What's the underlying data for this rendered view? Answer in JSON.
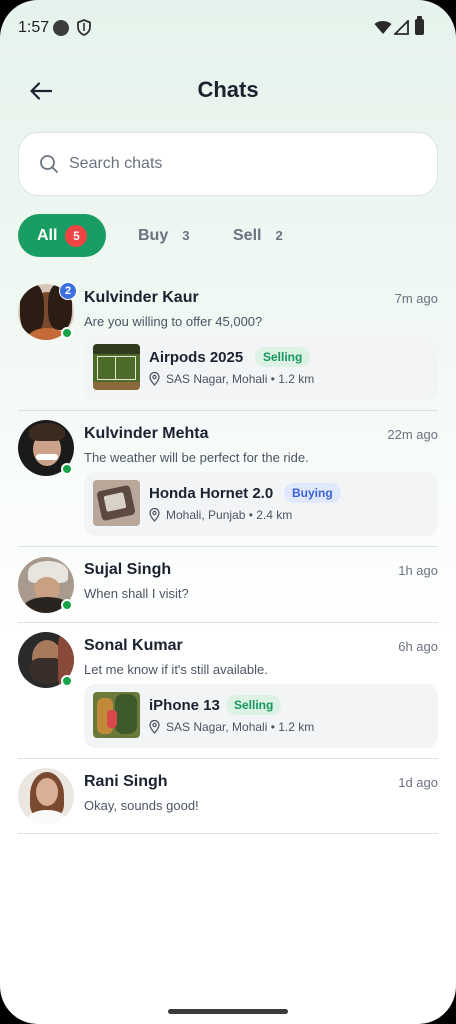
{
  "status_bar": {
    "time": "1:57"
  },
  "header": {
    "title": "Chats",
    "back_icon": "arrow-left-icon"
  },
  "search": {
    "placeholder": "Search chats",
    "icon": "search-icon"
  },
  "filters": [
    {
      "label": "All",
      "count": "5",
      "active": true
    },
    {
      "label": "Buy",
      "count": "3",
      "active": false
    },
    {
      "label": "Sell",
      "count": "2",
      "active": false
    }
  ],
  "chats": [
    {
      "name": "Kulvinder Kaur",
      "time": "7m ago",
      "message": "Are you willing to offer  45,000?",
      "unread": "2",
      "online": true,
      "listing": {
        "title": "Airpods 2025",
        "tag": "Selling",
        "location": "SAS Nagar, Mohali • 1.2 km"
      }
    },
    {
      "name": "Kulvinder Mehta",
      "time": "22m ago",
      "message": "The weather will be perfect for the ride.",
      "online": true,
      "listing": {
        "title": "Honda Hornet 2.0",
        "tag": "Buying",
        "location": "Mohali, Punjab • 2.4 km"
      }
    },
    {
      "name": "Sujal Singh",
      "time": "1h ago",
      "message": "When shall I visit?",
      "online": true
    },
    {
      "name": "Sonal Kumar",
      "time": "6h ago",
      "message": "Let me know if it's still available.",
      "online": true,
      "listing": {
        "title": "iPhone 13",
        "tag": "Selling",
        "location": "SAS Nagar, Mohali • 1.2 km"
      }
    },
    {
      "name": "Rani Singh",
      "time": "1d ago",
      "message": "Okay, sounds good!",
      "online": false
    }
  ],
  "colors": {
    "accent": "#1a9d62",
    "badge": "#ef4444",
    "unread": "#3b6fe0",
    "online": "#16a34a",
    "selling": "#16965a",
    "buying": "#3b63d8"
  }
}
